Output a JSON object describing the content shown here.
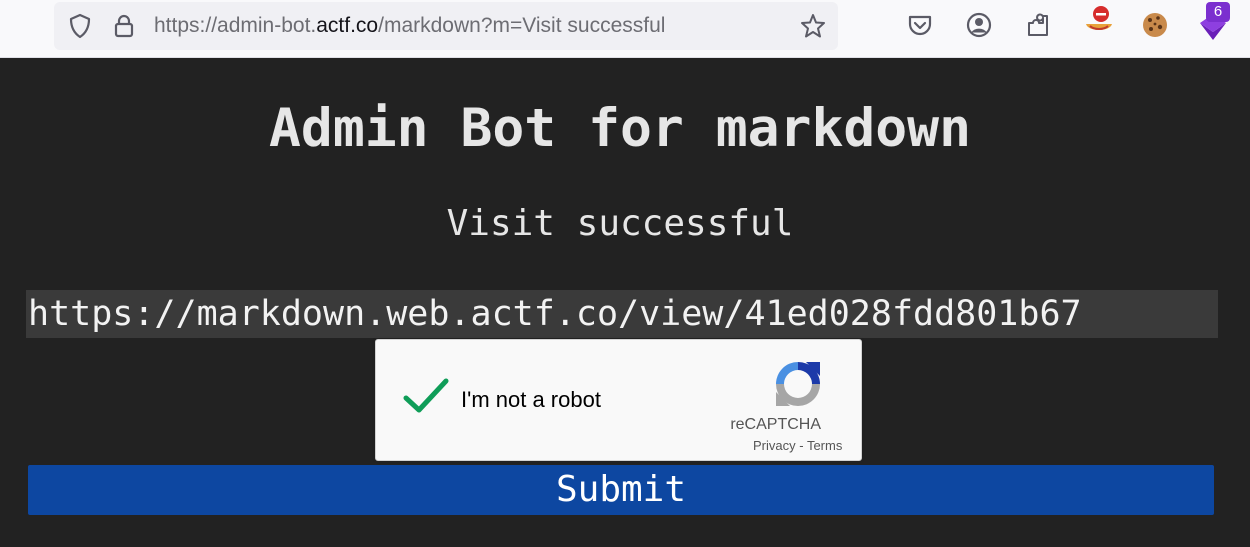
{
  "browser": {
    "url_prefix": "https://admin-bot.",
    "url_host": "actf.co",
    "url_suffix": "/markdown?m=Visit successful",
    "extension_badge": "6",
    "icons": [
      "tracking-protection-shield-icon",
      "lock-icon",
      "bookmark-star-icon",
      "pocket-icon",
      "account-icon",
      "extensions-puzzle-icon",
      "blocked-extension-icon",
      "cookie-icon",
      "purple-extension-icon"
    ]
  },
  "page": {
    "title": "Admin Bot for markdown",
    "message": "Visit successful",
    "url_field_value": "https://markdown.web.actf.co/view/41ed028fdd801b67",
    "submit_label": "Submit"
  },
  "recaptcha": {
    "checkbox_label": "I'm not a robot",
    "brand": "reCAPTCHA",
    "privacy": "Privacy",
    "separator": " - ",
    "terms": "Terms",
    "checked_color": "#0f9d58"
  },
  "colors": {
    "background": "#222222",
    "submit": "#0d47a1",
    "text": "#e6e6e6"
  }
}
